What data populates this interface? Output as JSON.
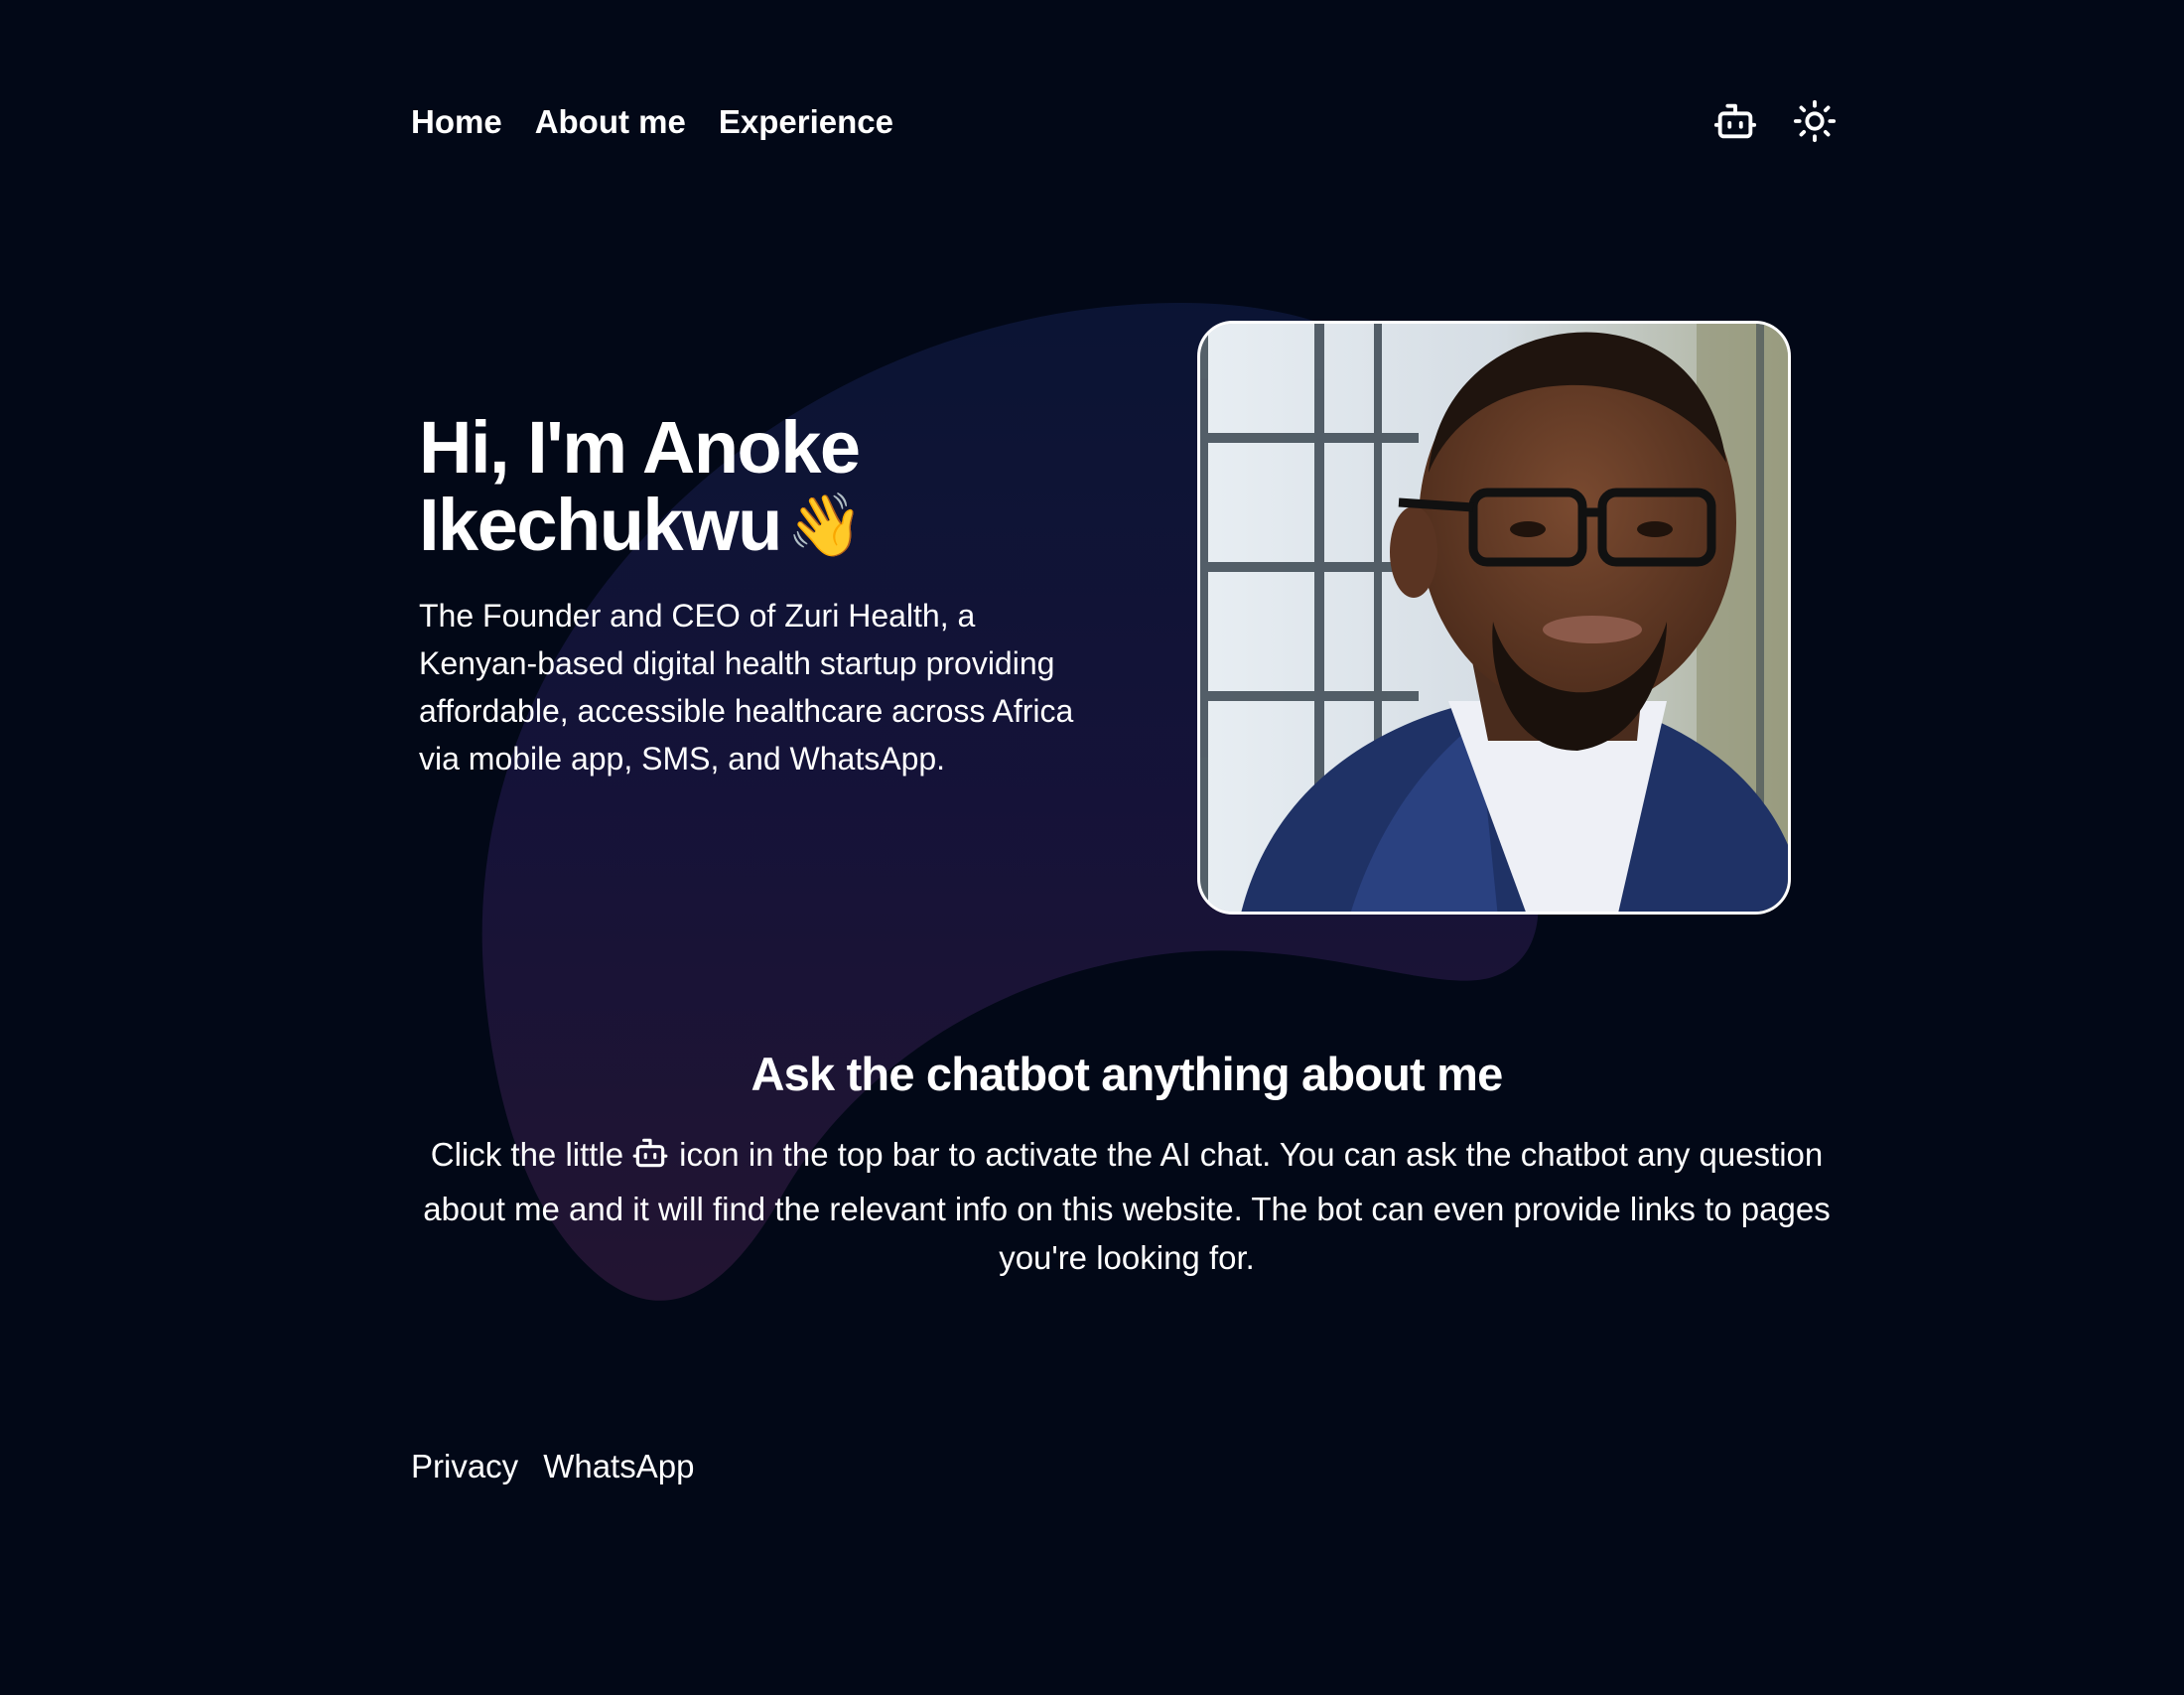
{
  "nav": {
    "links": [
      {
        "label": "Home"
      },
      {
        "label": "About me"
      },
      {
        "label": "Experience"
      }
    ],
    "icons": [
      "bot-icon",
      "sun-icon"
    ]
  },
  "hero": {
    "title": "Hi, I'm Anoke Ikechukwu",
    "emoji": "👋",
    "description": "The Founder and CEO of Zuri Health, a Kenyan-based digital health startup providing affordable, accessible healthcare across Africa via mobile app, SMS, and WhatsApp."
  },
  "chatbot": {
    "heading": "Ask the chatbot anything about me",
    "text_before_icon": "Click the little",
    "text_after_icon": "icon in the top bar to activate the AI chat. You can ask the chatbot any question about me and it will find the relevant info on this website. The bot can even provide links to pages you're looking for."
  },
  "footer": {
    "links": [
      {
        "label": "Privacy"
      },
      {
        "label": "WhatsApp"
      }
    ]
  },
  "colors": {
    "background": "#020817",
    "text": "#ffffff",
    "blob_top": "#0b1535",
    "blob_bottom": "#241533"
  }
}
